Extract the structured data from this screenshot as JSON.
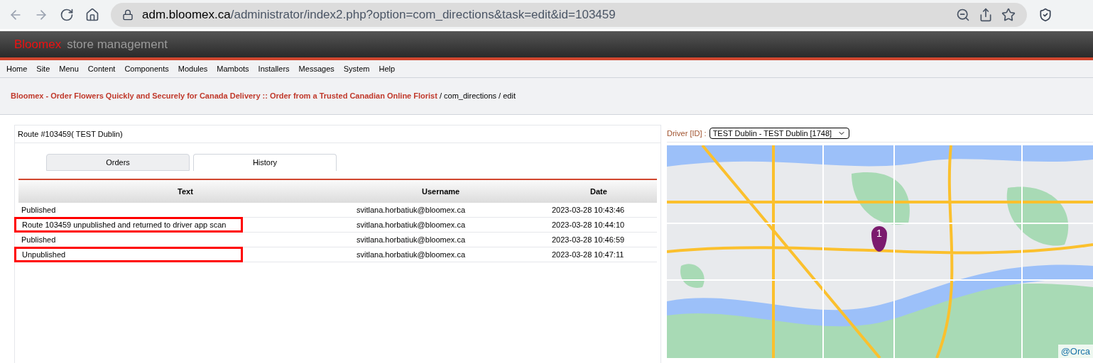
{
  "browser": {
    "url_host": "adm.bloomex.ca",
    "url_path": "/administrator/index2.php?option=com_directions&task=edit&id=103459"
  },
  "header": {
    "brand": "Bloomex",
    "subtitle": "store management"
  },
  "menu": [
    "Home",
    "Site",
    "Menu",
    "Content",
    "Components",
    "Modules",
    "Mambots",
    "Installers",
    "Messages",
    "System",
    "Help"
  ],
  "breadcrumb": {
    "site": "Bloomex - Order Flowers Quickly and Securely for Canada Delivery :: Order from a Trusted Canadian Online Florist",
    "path": " / com_directions / edit"
  },
  "route": {
    "title": "Route #103459( TEST Dublin)"
  },
  "tabs": [
    {
      "label": "Orders",
      "selected": false
    },
    {
      "label": "History",
      "selected": true
    }
  ],
  "table": {
    "columns": [
      "Text",
      "Username",
      "Date"
    ],
    "rows": [
      {
        "text": "Published",
        "username": "svitlana.horbatiuk@bloomex.ca",
        "date": "2023-03-28 10:43:46",
        "highlighted": false
      },
      {
        "text": "Route 103459 unpublished and returned to driver app scan",
        "username": "svitlana.horbatiuk@bloomex.ca",
        "date": "2023-03-28 10:44:10",
        "highlighted": true
      },
      {
        "text": "Published",
        "username": "svitlana.horbatiuk@bloomex.ca",
        "date": "2023-03-28 10:46:59",
        "highlighted": false
      },
      {
        "text": "Unpublished",
        "username": "svitlana.horbatiuk@bloomex.ca",
        "date": "2023-03-28 10:47:11",
        "highlighted": true
      }
    ]
  },
  "driver": {
    "label": "Driver [ID] :",
    "value": "TEST Dublin - TEST Dublin [1748]"
  },
  "map": {
    "marker": "1",
    "attribution": "@Orca"
  }
}
